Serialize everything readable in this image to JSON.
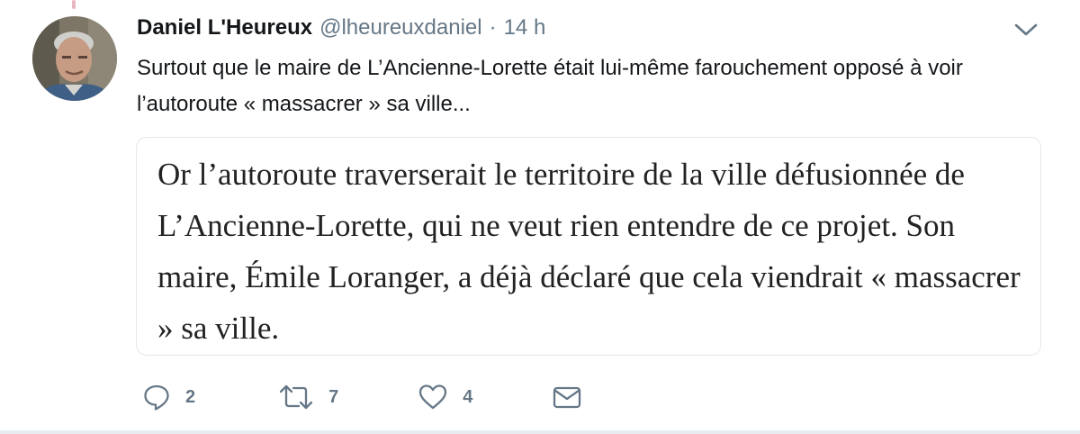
{
  "tweet": {
    "author": {
      "name": "Daniel L'Heureux",
      "handle": "@lheureuxdaniel",
      "avatar_icon": "person-avatar"
    },
    "separator": "·",
    "time": "14 h",
    "text": "Surtout que le maire de L’Ancienne-Lorette était lui-même farouchement opposé à voir l’autoroute « massacrer » sa ville...",
    "quote_image_text": "Or l’autoroute traverserait le territoire de la ville défusionnée de L’Ancienne-Lorette, qui ne veut rien entendre de ce projet. Son maire, Émile Loranger, a déjà déclaré que cela viendrait « massacrer » sa ville.",
    "actions": {
      "reply": {
        "icon": "reply-icon",
        "count": "2"
      },
      "retweet": {
        "icon": "retweet-icon",
        "count": "7"
      },
      "like": {
        "icon": "heart-icon",
        "count": "4"
      },
      "message": {
        "icon": "envelope-icon"
      }
    },
    "menu_icon": "chevron-down-icon"
  },
  "colors": {
    "text_primary": "#14171a",
    "text_secondary": "#657786",
    "border": "#e1e8ed",
    "thread_line": "#e8b7c2"
  }
}
